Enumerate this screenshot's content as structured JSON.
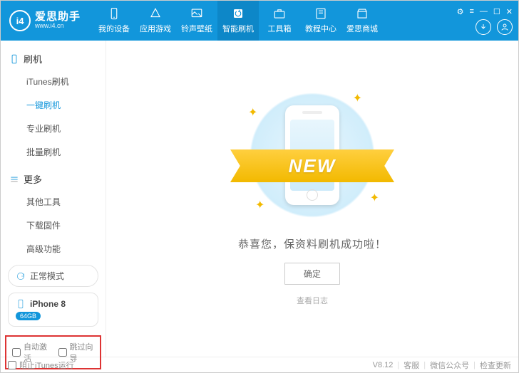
{
  "app": {
    "name": "爱思助手",
    "url": "www.i4.cn",
    "logo_text": "i4",
    "version": "V8.12"
  },
  "nav": [
    {
      "label": "我的设备",
      "icon": "phone"
    },
    {
      "label": "应用游戏",
      "icon": "triangle"
    },
    {
      "label": "铃声壁纸",
      "icon": "image"
    },
    {
      "label": "智能刷机",
      "icon": "refresh",
      "active": true
    },
    {
      "label": "工具箱",
      "icon": "briefcase"
    },
    {
      "label": "教程中心",
      "icon": "book"
    },
    {
      "label": "爱思商城",
      "icon": "shop"
    }
  ],
  "sidebar": {
    "groups": [
      {
        "title": "刷机",
        "icon": "phone",
        "items": [
          {
            "label": "iTunes刷机"
          },
          {
            "label": "一键刷机",
            "active": true
          },
          {
            "label": "专业刷机"
          },
          {
            "label": "批量刷机"
          }
        ]
      },
      {
        "title": "更多",
        "icon": "menu",
        "items": [
          {
            "label": "其他工具"
          },
          {
            "label": "下载固件"
          },
          {
            "label": "高级功能"
          }
        ]
      }
    ],
    "mode": "正常模式",
    "device": {
      "name": "iPhone 8",
      "storage": "64GB"
    },
    "auto_activate": "自动激活",
    "skip_guide": "跳过向导"
  },
  "content": {
    "ribbon": "NEW",
    "success": "恭喜您，保资料刷机成功啦！",
    "ok": "确定",
    "view_log": "查看日志"
  },
  "footer": {
    "block_itunes": "阻止iTunes运行",
    "service": "客服",
    "wechat": "微信公众号",
    "check_update": "检查更新"
  }
}
